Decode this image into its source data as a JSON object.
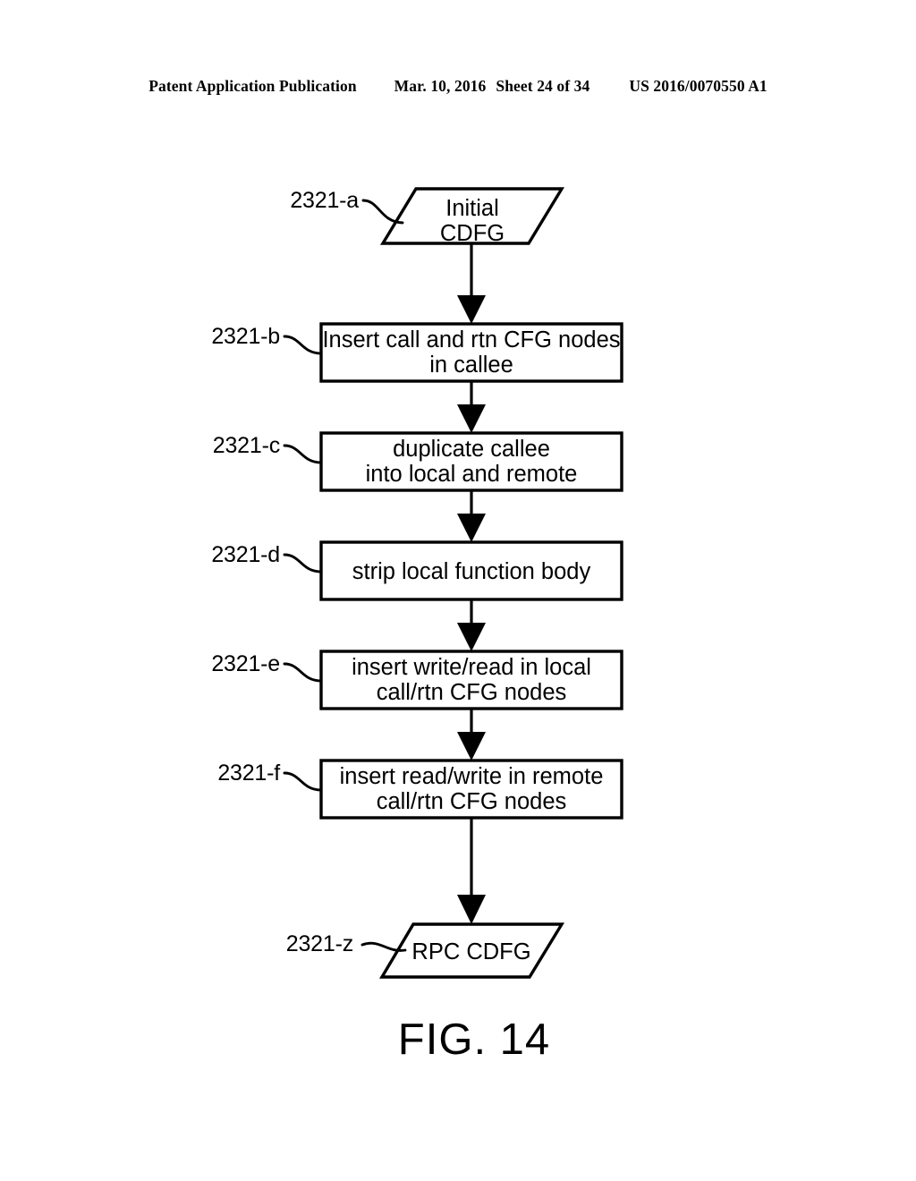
{
  "header": {
    "publication": "Patent Application Publication",
    "date": "Mar. 10, 2016",
    "sheet": "Sheet 24 of 34",
    "patent_number": "US 2016/0070550 A1"
  },
  "figure": {
    "caption": "FIG. 14",
    "ink_color": "#000000",
    "background_color": "#ffffff"
  },
  "flowchart": {
    "nodes": [
      {
        "ref": "2321-a",
        "shape": "parallelogram",
        "line1": "Initial",
        "line2": "CDFG"
      },
      {
        "ref": "2321-b",
        "shape": "rectangle",
        "line1": "Insert call and rtn CFG nodes",
        "line2": "in callee"
      },
      {
        "ref": "2321-c",
        "shape": "rectangle",
        "line1": "duplicate callee",
        "line2": "into local and remote"
      },
      {
        "ref": "2321-d",
        "shape": "rectangle",
        "line1": "strip local function body",
        "line2": ""
      },
      {
        "ref": "2321-e",
        "shape": "rectangle",
        "line1": "insert write/read in local",
        "line2": "call/rtn CFG nodes"
      },
      {
        "ref": "2321-f",
        "shape": "rectangle",
        "line1": "insert read/write in remote",
        "line2": "call/rtn CFG nodes"
      },
      {
        "ref": "2321-z",
        "shape": "parallelogram",
        "line1": "RPC CDFG",
        "line2": ""
      }
    ]
  }
}
